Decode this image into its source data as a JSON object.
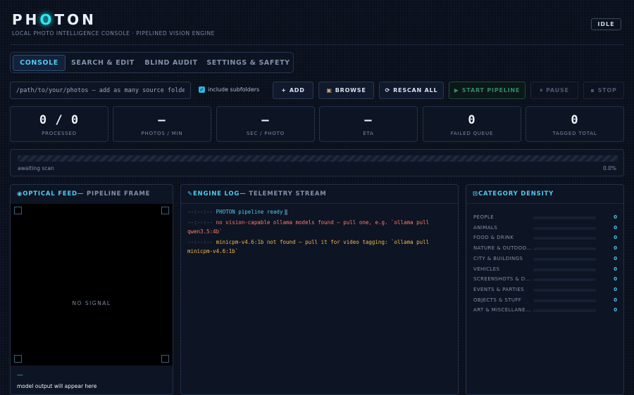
{
  "header": {
    "logo": [
      "PH",
      "O",
      "T",
      "O",
      "N"
    ],
    "subtitle": "LOCAL PHOTO INTELLIGENCE CONSOLE · PIPELINED VISION ENGINE",
    "status": "IDLE"
  },
  "tabs": [
    {
      "label": "CONSOLE",
      "active": true
    },
    {
      "label": "SEARCH & EDIT",
      "active": false
    },
    {
      "label": "BLIND AUDIT",
      "active": false
    },
    {
      "label": "SETTINGS & SAFETY",
      "active": false
    }
  ],
  "source": {
    "path_placeholder": "/path/to/your/photos — add as many source folders",
    "path_value": "",
    "include_subfolders_label": "include subfolders",
    "include_subfolders_checked": true
  },
  "toolbar": {
    "add": {
      "icon": "plus-icon",
      "glyph": "+",
      "label": "ADD"
    },
    "browse": {
      "icon": "folder-icon",
      "glyph": "▣",
      "label": "BROWSE"
    },
    "rescan": {
      "icon": "refresh-icon",
      "glyph": "⟳",
      "label": "RESCAN ALL"
    },
    "start": {
      "icon": "play-icon",
      "glyph": "▶",
      "label": "START PIPELINE"
    },
    "pause": {
      "icon": "pause-icon",
      "glyph": "⏸",
      "label": "PAUSE"
    },
    "stop": {
      "icon": "stop-icon",
      "glyph": "▪",
      "label": "STOP"
    }
  },
  "stats": [
    {
      "value": "0 / 0",
      "label": "PROCESSED"
    },
    {
      "value": "—",
      "label": "PHOTOS / MIN"
    },
    {
      "value": "—",
      "label": "SEC / PHOTO"
    },
    {
      "value": "—",
      "label": "ETA"
    },
    {
      "value": "0",
      "label": "FAILED QUEUE"
    },
    {
      "value": "0",
      "label": "TAGGED TOTAL"
    }
  ],
  "progress": {
    "status": "awaiting scan",
    "percent_label": "0.0%",
    "fraction": 0.0
  },
  "optical_feed": {
    "icon": "eye-icon",
    "title": "OPTICAL FEED",
    "subtitle": "— PIPELINE FRAME",
    "no_signal": "NO SIGNAL",
    "dash": "—",
    "output_placeholder": "model output will appear here"
  },
  "engine_log": {
    "icon": "wrench-icon",
    "title": "ENGINE LOG",
    "subtitle": "— TELEMETRY STREAM",
    "entries": [
      {
        "time": "--:--:--",
        "level": "info",
        "message": "PHOTON pipeline ready"
      },
      {
        "time": "--:--:--",
        "level": "error",
        "message": "no vision-capable ollama models found — pull one, e.g. `ollama pull qwen3.5:4b`"
      },
      {
        "time": "--:--:--",
        "level": "warn",
        "message": "minicpm-v4.6:1b not found — pull it for video tagging: `ollama pull minicpm-v4.6:1b`"
      }
    ]
  },
  "category_density": {
    "icon": "grid-icon",
    "title": "CATEGORY DENSITY",
    "categories": [
      {
        "name": "PEOPLE",
        "count": 0
      },
      {
        "name": "ANIMALS",
        "count": 0
      },
      {
        "name": "FOOD & DRINK",
        "count": 0
      },
      {
        "name": "NATURE & OUTDOO...",
        "count": 0
      },
      {
        "name": "CITY & BUILDINGS",
        "count": 0
      },
      {
        "name": "VEHICLES",
        "count": 0
      },
      {
        "name": "SCREENSHOTS & D...",
        "count": 0
      },
      {
        "name": "EVENTS & PARTIES",
        "count": 0
      },
      {
        "name": "OBJECTS & STUFF",
        "count": 0
      },
      {
        "name": "ART & MISCELLANE...",
        "count": 0
      }
    ]
  },
  "colors": {
    "accent": "#2ee6f0",
    "info": "#52c8f0",
    "error": "#ff7a66",
    "warn": "#f2b84b",
    "start": "#2f8c6a"
  }
}
